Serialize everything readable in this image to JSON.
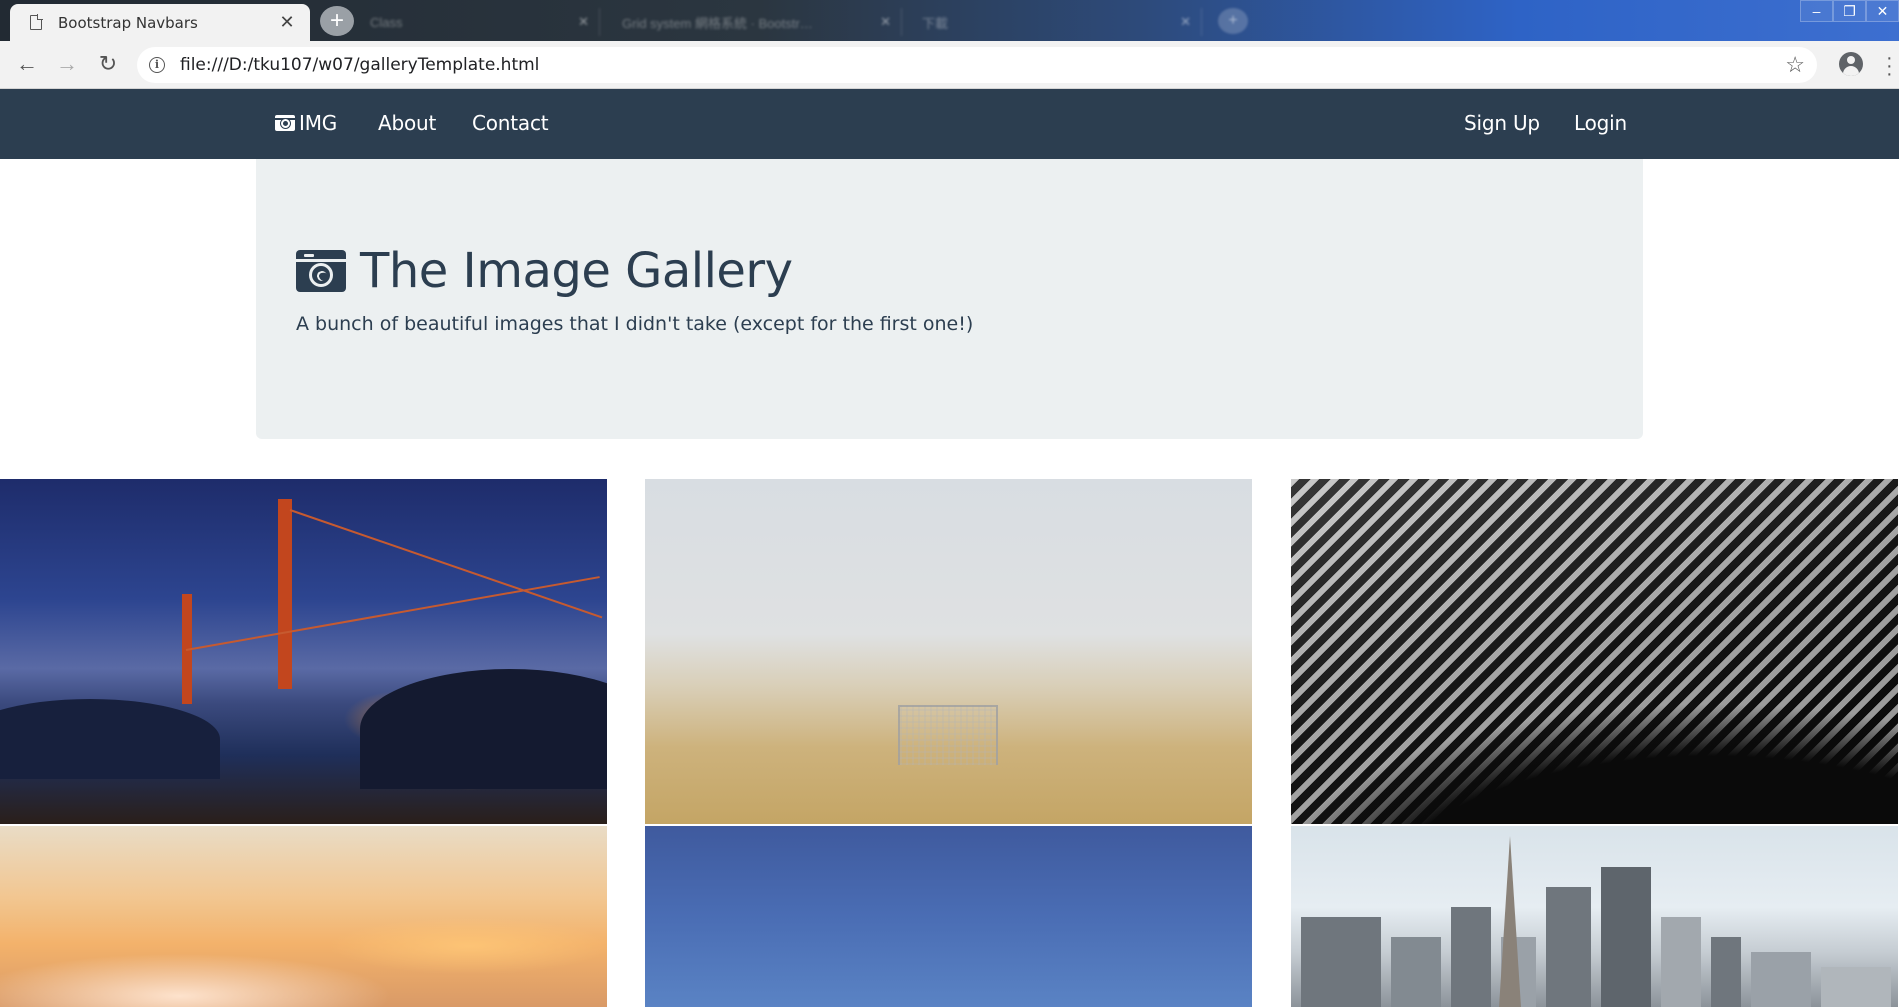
{
  "browser": {
    "active_tab_title": "Bootstrap Navbars",
    "background_tabs": [
      "Class",
      "Grid system 網格系統 · Bootstr…",
      "下載"
    ],
    "url": "file:///D:/tku107/w07/galleryTemplate.html"
  },
  "navbar": {
    "brand": "IMG",
    "left_links": [
      "About",
      "Contact"
    ],
    "right_links": [
      "Sign Up",
      "Login"
    ],
    "background_color": "#2c3e50"
  },
  "jumbotron": {
    "title": "The Image Gallery",
    "subtitle": "A bunch of beautiful images that I didn't take (except for the first one!)",
    "background_color": "#ecf0f1"
  },
  "gallery": {
    "images": [
      "golden-gate-bridge",
      "foggy-soccer-goal",
      "abstract-architecture",
      "sunset-clouds",
      "blue-sky",
      "city-skyline"
    ]
  }
}
